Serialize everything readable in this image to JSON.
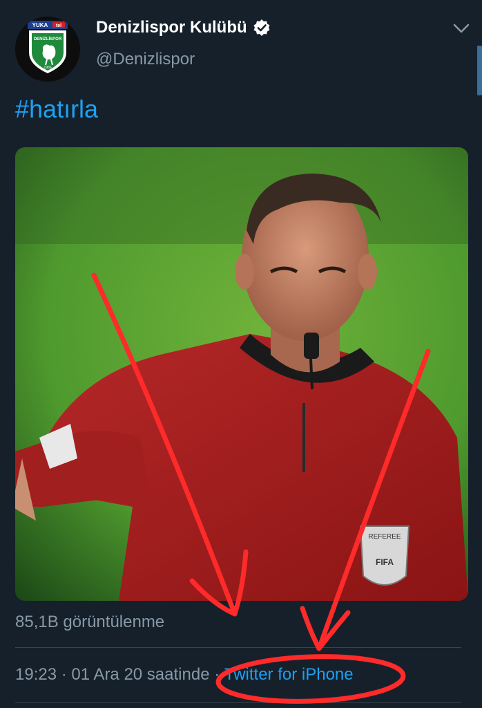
{
  "header": {
    "display_name": "Denizlispor Kulübü",
    "handle": "@Denizlispor",
    "avatar": {
      "badge_top": "YUKA",
      "badge_top2": "tel",
      "club_text": "DENİZLİSPOR",
      "year": "1966"
    }
  },
  "tweet": {
    "text": "#hatırla",
    "media": {
      "alt_visible": "",
      "patch_text": "REFEREE",
      "patch_text2": "FIFA"
    }
  },
  "stats": {
    "views": "85,1B görüntülenme"
  },
  "meta": {
    "time": "19:23",
    "sep1": " · ",
    "date": "01 Ara 20",
    "suffix": " saatinde",
    "sep2": " · ",
    "source": "Twitter for iPhone"
  },
  "colors": {
    "background": "#15202b",
    "accent": "#1da1f2",
    "secondary_text": "#8899a6",
    "annotation": "#ff2a2a"
  },
  "icons": {
    "verified": "verified-badge-icon",
    "more": "chevron-down-icon"
  }
}
